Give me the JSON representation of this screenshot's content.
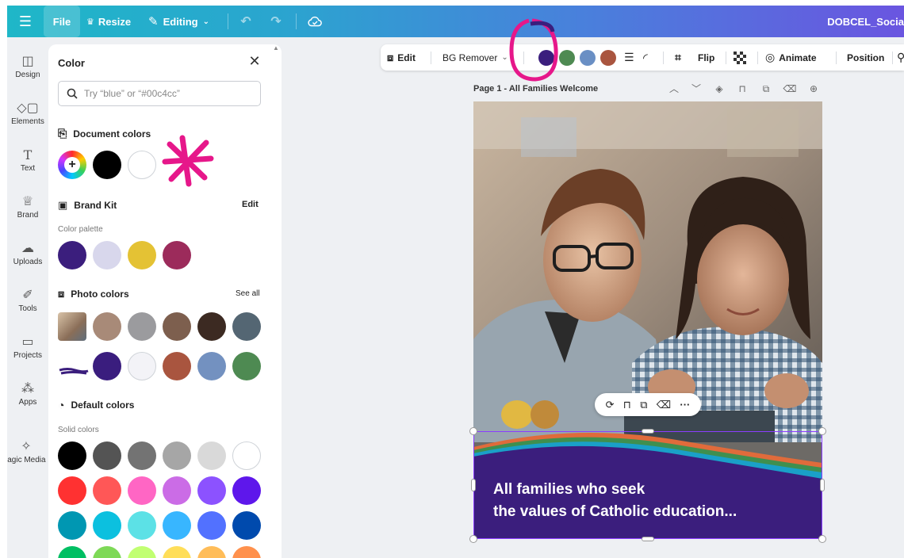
{
  "topbar": {
    "file_label": "File",
    "resize_label": "Resize",
    "editing_label": "Editing",
    "doc_title": "DOBCEL_Socia"
  },
  "rail": {
    "items": [
      {
        "label": "Design",
        "icon": "layout-icon"
      },
      {
        "label": "Elements",
        "icon": "shapes-icon"
      },
      {
        "label": "Text",
        "icon": "text-icon"
      },
      {
        "label": "Brand",
        "icon": "brand-crown-icon"
      },
      {
        "label": "Uploads",
        "icon": "cloud-upload-icon"
      },
      {
        "label": "Tools",
        "icon": "pen-icon"
      },
      {
        "label": "Projects",
        "icon": "folder-icon"
      },
      {
        "label": "Apps",
        "icon": "apps-grid-icon"
      },
      {
        "label": "lagic Media",
        "icon": "magic-media-icon"
      }
    ]
  },
  "panel": {
    "title": "Color",
    "search_placeholder": "Try “blue” or “#00c4cc”",
    "document_colors": {
      "heading": "Document colors",
      "swatches": [
        "#000000",
        "#ffffff"
      ]
    },
    "brand_kit": {
      "heading": "Brand Kit",
      "edit_label": "Edit",
      "palette_label": "Color palette",
      "swatches": [
        "#3b1e7d",
        "#d8d7ec",
        "#e4c234",
        "#9c2b5b"
      ]
    },
    "photo_colors": {
      "heading": "Photo colors",
      "see_all_label": "See all",
      "row1": [
        "#a88a78",
        "#9b9b9e",
        "#7d5f4e",
        "#3c2a22",
        "#546673"
      ],
      "row2": [
        "#3a1d7e",
        "#f3f3f7",
        "#a9553f",
        "#7391c0",
        "#4e8a52"
      ]
    },
    "default_colors": {
      "heading": "Default colors",
      "solid_label": "Solid colors",
      "rows": [
        [
          "#000000",
          "#545454",
          "#737373",
          "#a6a6a6",
          "#d9d9d9",
          "#ffffff"
        ],
        [
          "#ff3131",
          "#ff5757",
          "#ff66c4",
          "#cb6ce6",
          "#8c52ff",
          "#5e17eb"
        ],
        [
          "#0097b2",
          "#0cc0df",
          "#5ce1e6",
          "#38b6ff",
          "#5271ff",
          "#004aad"
        ],
        [
          "#00bf63",
          "#7ed957",
          "#c1ff72",
          "#ffde59",
          "#ffbd59",
          "#ff914d"
        ]
      ]
    }
  },
  "context_toolbar": {
    "edit_label": "Edit",
    "bg_remover_label": "BG Remover",
    "color_dots": [
      "#3b1e7d",
      "#4e8a52",
      "#6a8fc4",
      "#a9553f"
    ],
    "flip_label": "Flip",
    "animate_label": "Animate",
    "position_label": "Position"
  },
  "page": {
    "title": "Page 1 - All Families Welcome",
    "banner_line1": "All families who seek",
    "banner_line2": "the values of Catholic education..."
  },
  "colors": {
    "accent_purple": "#8b3dff",
    "banner_purple": "#3b1e7d",
    "annotation_magenta": "#e6178a"
  }
}
